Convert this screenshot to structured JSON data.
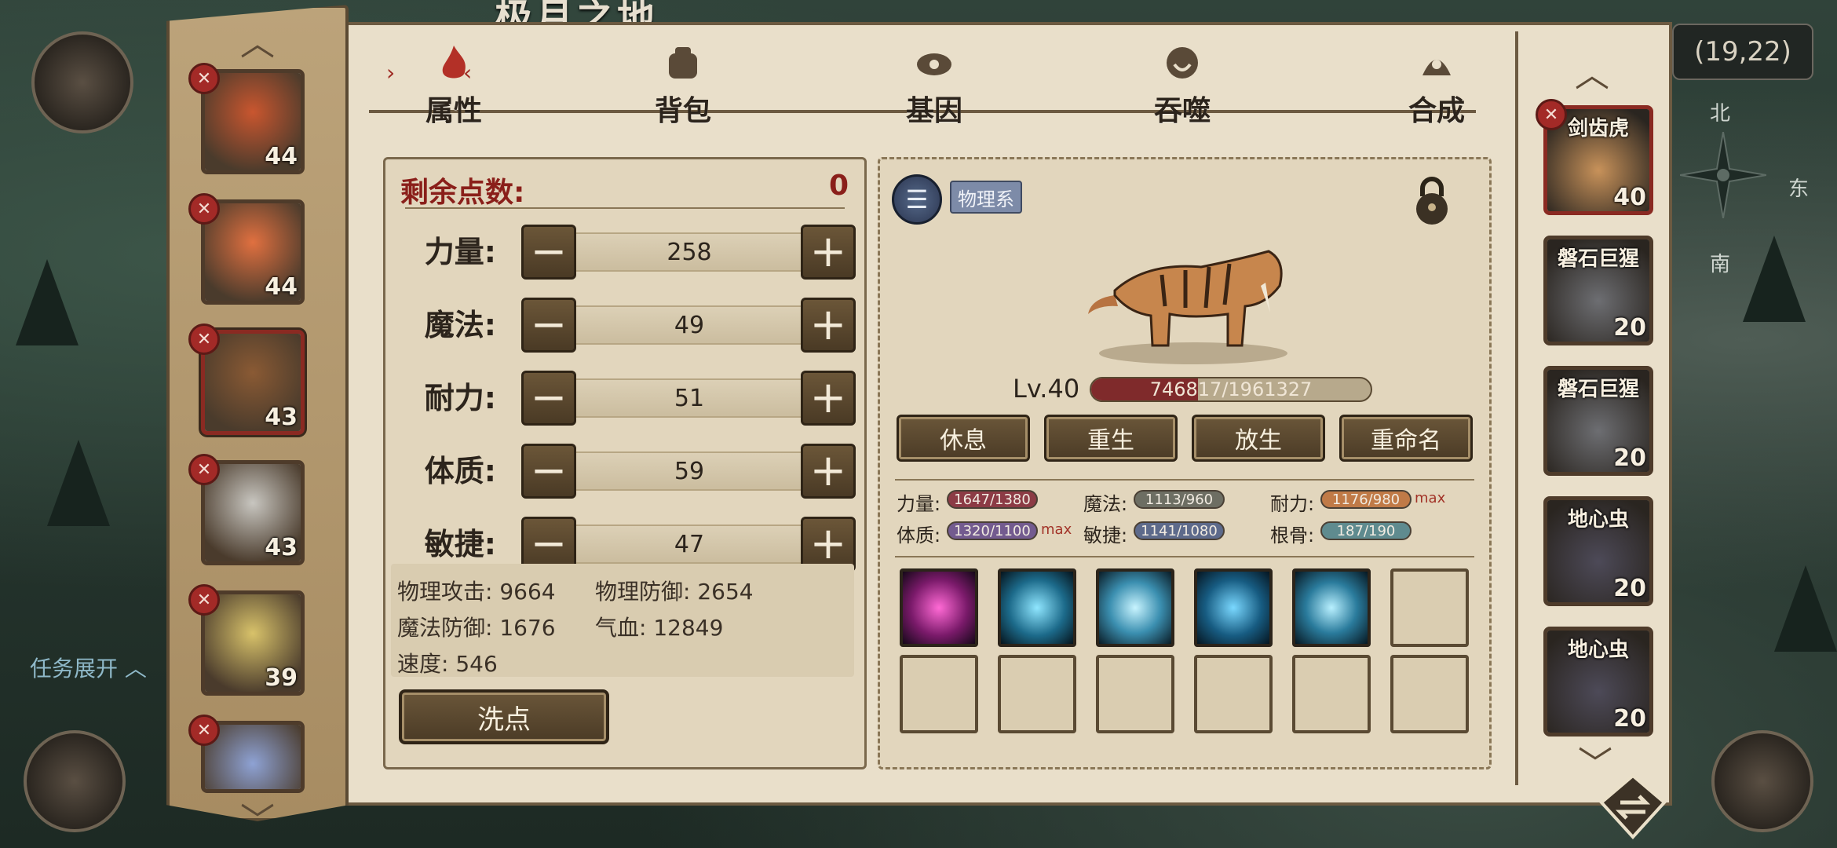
{
  "map": {
    "title": "极月之地",
    "coords": "(19,22)",
    "compass": {
      "north": "北",
      "east": "东",
      "south": "南"
    }
  },
  "task_toggle": "任务展开",
  "tabs": [
    {
      "label": "属性",
      "icon": "flame-icon",
      "active": true
    },
    {
      "label": "背包",
      "icon": "bag-icon",
      "active": false
    },
    {
      "label": "基因",
      "icon": "gene-icon",
      "active": false
    },
    {
      "label": "吞噬",
      "icon": "devour-icon",
      "active": false
    },
    {
      "label": "合成",
      "icon": "craft-icon",
      "active": false
    }
  ],
  "left_pets": [
    {
      "level": "44",
      "selected": false
    },
    {
      "level": "44",
      "selected": false
    },
    {
      "level": "43",
      "selected": true
    },
    {
      "level": "43",
      "selected": false
    },
    {
      "level": "39",
      "selected": false
    },
    {
      "level": "",
      "selected": false
    }
  ],
  "attributes": {
    "remaining_label": "剩余点数:",
    "remaining_value": "0",
    "stats": [
      {
        "label": "力量:",
        "value": "258"
      },
      {
        "label": "魔法:",
        "value": "49"
      },
      {
        "label": "耐力:",
        "value": "51"
      },
      {
        "label": "体质:",
        "value": "59"
      },
      {
        "label": "敏捷:",
        "value": "47"
      }
    ],
    "derived": {
      "phys_atk": "物理攻击: 9664",
      "phys_def": "物理防御: 2654",
      "mag_def": "魔法防御: 1676",
      "hp": "气血: 12849",
      "speed": "速度: 546"
    },
    "wash_label": "洗点"
  },
  "pet": {
    "type_tag": "物理系",
    "level_text": "Lv.40",
    "hp_text": "746817/1961327",
    "hp_fraction": 0.381,
    "actions": [
      "休息",
      "重生",
      "放生",
      "重命名"
    ],
    "growth": [
      {
        "label": "力量:",
        "value": "1647/1380",
        "color": "#8c3b45",
        "max": ""
      },
      {
        "label": "魔法:",
        "value": "1113/960",
        "color": "#6d6e63",
        "max": ""
      },
      {
        "label": "耐力:",
        "value": "1176/980",
        "color": "#c07a47",
        "max": "max"
      },
      {
        "label": "体质:",
        "value": "1320/1100",
        "color": "#735b8f",
        "max": "max"
      },
      {
        "label": "敏捷:",
        "value": "1141/1080",
        "color": "#5d6a8b",
        "max": ""
      },
      {
        "label": "根骨:",
        "value": "187/190",
        "color": "#5f8b8f",
        "max": ""
      }
    ],
    "skills": [
      "pink-claw-icon",
      "blue-slash-icon",
      "ice-shard-icon",
      "water-orb-icon",
      "lightning-icon",
      "",
      "",
      "",
      "",
      "",
      "",
      ""
    ]
  },
  "right_pets": [
    {
      "name": "剑齿虎",
      "level": "40",
      "selected": true
    },
    {
      "name": "磐石巨猩",
      "level": "20",
      "selected": false
    },
    {
      "name": "磐石巨猩",
      "level": "20",
      "selected": false
    },
    {
      "name": "地心虫",
      "level": "20",
      "selected": false
    },
    {
      "name": "地心虫",
      "level": "20",
      "selected": false
    }
  ],
  "colors": {
    "accent_red": "#8a1f1a",
    "parchment": "#e9dfca",
    "button_brown": "#5a4630"
  }
}
